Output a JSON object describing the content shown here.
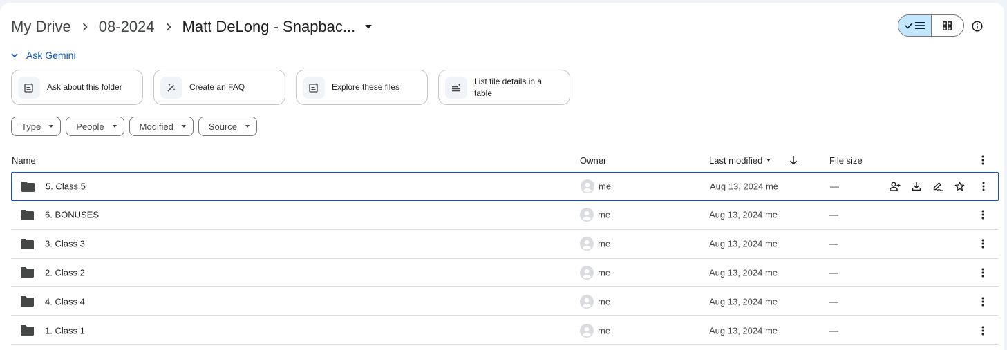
{
  "breadcrumb": {
    "items": [
      "My Drive",
      "08-2024"
    ],
    "current": "Matt DeLong - Snapbac..."
  },
  "gemini": {
    "label": "Ask Gemini"
  },
  "suggestions": [
    {
      "label": "Ask about this folder",
      "icon": "doc-spark-icon"
    },
    {
      "label": "Create an FAQ",
      "icon": "magic-pen-icon"
    },
    {
      "label": "Explore these files",
      "icon": "doc-spark-icon"
    },
    {
      "label": "List file details in a table",
      "icon": "list-spark-icon"
    }
  ],
  "filters": [
    "Type",
    "People",
    "Modified",
    "Source"
  ],
  "table": {
    "headers": {
      "name": "Name",
      "owner": "Owner",
      "modified": "Last modified",
      "size": "File size"
    },
    "rows": [
      {
        "name": "5. Class 5",
        "owner": "me",
        "modified": "Aug 13, 2024 me",
        "size": "—",
        "selected": true
      },
      {
        "name": "6. BONUSES",
        "owner": "me",
        "modified": "Aug 13, 2024 me",
        "size": "—"
      },
      {
        "name": "3. Class 3",
        "owner": "me",
        "modified": "Aug 13, 2024 me",
        "size": "—"
      },
      {
        "name": "2. Class 2",
        "owner": "me",
        "modified": "Aug 13, 2024 me",
        "size": "—"
      },
      {
        "name": "4. Class 4",
        "owner": "me",
        "modified": "Aug 13, 2024 me",
        "size": "—"
      },
      {
        "name": "1. Class 1",
        "owner": "me",
        "modified": "Aug 13, 2024 me",
        "size": "—"
      }
    ]
  },
  "colors": {
    "accent": "#0b57d0",
    "toggle_active": "#c2e7ff",
    "folder": "#444746",
    "divider": "#dadce0"
  }
}
